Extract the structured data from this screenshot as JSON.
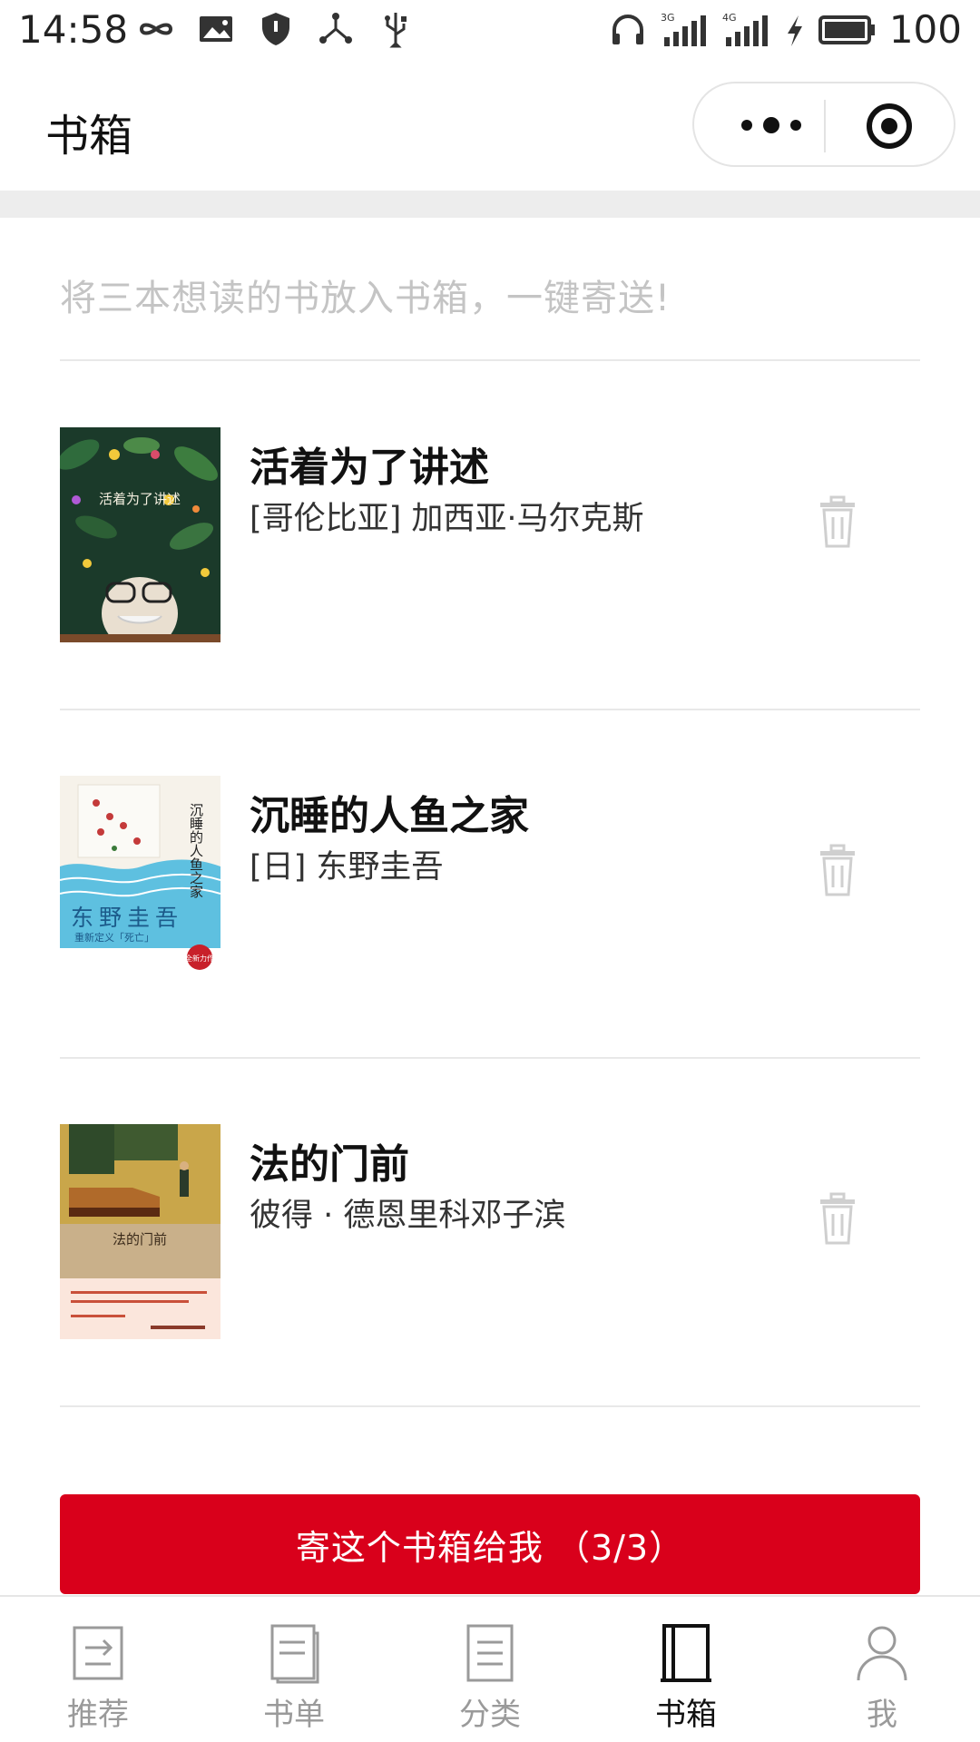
{
  "status_bar": {
    "time": "14:58",
    "battery": "100",
    "network_3g": "3G",
    "network_4g": "4G"
  },
  "header": {
    "title": "书箱"
  },
  "hint": "将三本想读的书放入书箱，一键寄送!",
  "books": [
    {
      "title": "活着为了讲述",
      "author": "[哥伦比亚] 加西亚·马尔克斯",
      "cover_text": "活着为了讲述"
    },
    {
      "title": "沉睡的人鱼之家",
      "author": "[日] 东野圭吾",
      "cover_text": "沉睡的人鱼之家",
      "cover_author": "东野圭吾",
      "cover_tagline": "重新定义「死亡」",
      "cover_badge": "全新力作"
    },
    {
      "title": "法的门前",
      "author": "彼得 · 德恩里科邓子滨",
      "cover_text": "法的门前"
    }
  ],
  "send_button": "寄这个书箱给我 （3/3）",
  "tabs": [
    {
      "label": "推荐",
      "icon": "recommend-icon"
    },
    {
      "label": "书单",
      "icon": "booklist-icon"
    },
    {
      "label": "分类",
      "icon": "category-icon"
    },
    {
      "label": "书箱",
      "icon": "bookbox-icon"
    },
    {
      "label": "我",
      "icon": "profile-icon"
    }
  ],
  "colors": {
    "accent": "#d9001b",
    "tab_inactive": "#9a9a9a",
    "tab_active": "#111111",
    "hint": "#c4c4c4"
  }
}
